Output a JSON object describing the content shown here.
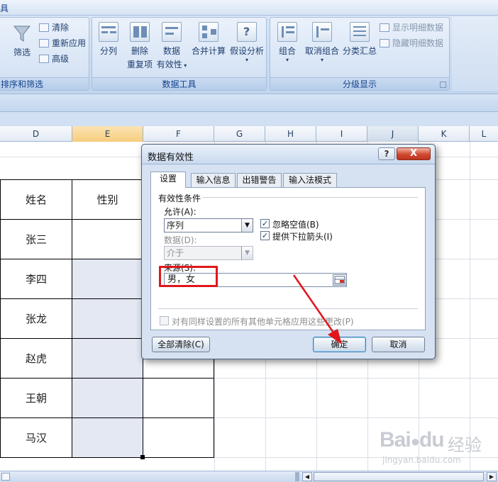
{
  "ribbon": {
    "top_left_fragment": "具",
    "sort_filter": {
      "label": "排序和筛选",
      "filter": "筛选",
      "clear": "清除",
      "reapply": "重新应用",
      "advanced": "高级"
    },
    "data_tools": {
      "label": "数据工具",
      "text_to_columns": "分列",
      "remove_duplicates_1": "删除",
      "remove_duplicates_2": "重复项",
      "validation_1": "数据",
      "validation_2": "有效性",
      "consolidate": "合并计算",
      "what_if": "假设分析"
    },
    "outline": {
      "label": "分级显示",
      "group": "组合",
      "ungroup": "取消组合",
      "subtotal": "分类汇总",
      "show_detail": "显示明细数据",
      "hide_detail": "隐藏明细数据"
    }
  },
  "grid": {
    "columns": [
      "D",
      "E",
      "F",
      "G",
      "H",
      "I",
      "J",
      "K",
      "L"
    ],
    "selected_column": "E",
    "header_name": "姓名",
    "header_gender": "性别",
    "names": [
      "张三",
      "李四",
      "张龙",
      "赵虎",
      "王朝",
      "马汉"
    ]
  },
  "dialog": {
    "title": "数据有效性",
    "help": "?",
    "close": "X",
    "tabs": [
      "设置",
      "输入信息",
      "出错警告",
      "输入法模式"
    ],
    "active_tab": "设置",
    "section_title": "有效性条件",
    "allow_label": "允许(A):",
    "allow_value": "序列",
    "data_label": "数据(D):",
    "data_value": "介于",
    "source_label": "来源(S):",
    "source_value": "男，女",
    "ignore_blank": "忽略空值(B)",
    "ignore_blank_checked": true,
    "dropdown_arrow": "提供下拉箭头(I)",
    "dropdown_arrow_checked": true,
    "apply_all": "对有同样设置的所有其他单元格应用这些更改(P)",
    "apply_all_checked": false,
    "clear_all": "全部清除(C)",
    "ok": "确定",
    "cancel": "取消"
  },
  "watermark": {
    "brand": "Bai",
    "brand_suffix": "du",
    "product": "经验",
    "url": "jingyan.baidu.com"
  },
  "colors": {
    "highlight": "#e0161b",
    "arrow": "#e0161b",
    "selected_column": "#f7cd7d"
  }
}
